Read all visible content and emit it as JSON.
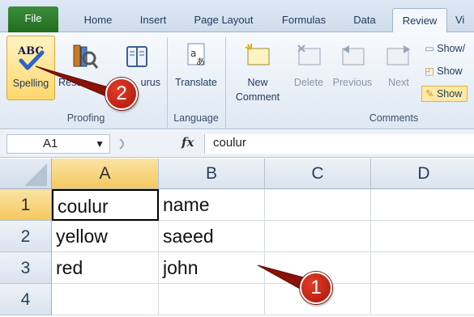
{
  "ribbon": {
    "tabs": [
      {
        "label": "File"
      },
      {
        "label": "Home"
      },
      {
        "label": "Insert"
      },
      {
        "label": "Page Layout"
      },
      {
        "label": "Formulas"
      },
      {
        "label": "Data"
      },
      {
        "label": "Review"
      },
      {
        "label": "Vi"
      }
    ],
    "active_tab": "Review",
    "groups": {
      "proofing": {
        "label": "Proofing",
        "spelling": "Spelling",
        "research": "Resea",
        "thesaurus": "urus"
      },
      "language": {
        "label": "Language",
        "translate": "Translate"
      },
      "comments": {
        "label": "Comments",
        "new_comment_line1": "New",
        "new_comment_line2": "Comment",
        "delete": "Delete",
        "previous": "Previous",
        "next": "Next",
        "show_hide": "Show/",
        "show_all": "Show",
        "show_ink": "Show"
      }
    }
  },
  "formula_bar": {
    "name_box": "A1",
    "fx_symbol": "fx",
    "value": "coulur"
  },
  "sheet": {
    "columns": [
      "A",
      "B",
      "C",
      "D"
    ],
    "rows": [
      "1",
      "2",
      "3",
      "4"
    ],
    "cells": [
      [
        "coulur",
        "name",
        "",
        ""
      ],
      [
        "yellow",
        "saeed",
        "",
        ""
      ],
      [
        "red",
        "john",
        "",
        ""
      ],
      [
        "",
        "",
        "",
        ""
      ]
    ],
    "active_cell": "A1"
  },
  "callouts": [
    {
      "number": "1"
    },
    {
      "number": "2"
    }
  ],
  "colors": {
    "file_tab": "#2e7d32",
    "selection_header": "#f5c85f",
    "callout": "#c0201a"
  }
}
